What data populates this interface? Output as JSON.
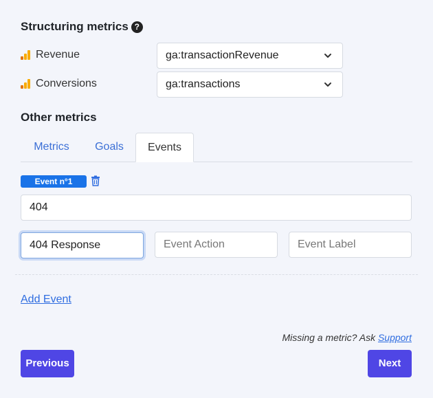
{
  "structuring": {
    "title": "Structuring metrics",
    "help_icon": "?",
    "rows": [
      {
        "label": "Revenue",
        "value": "ga:transactionRevenue"
      },
      {
        "label": "Conversions",
        "value": "ga:transactions"
      }
    ]
  },
  "other": {
    "title": "Other metrics",
    "tabs": [
      "Metrics",
      "Goals",
      "Events"
    ],
    "active_tab": "Events"
  },
  "event": {
    "badge": "Event n°1",
    "category_value": "404",
    "action_value": "404 Response",
    "action_placeholder": "Event Action",
    "label_placeholder": "Event Label"
  },
  "add_event_label": "Add Event",
  "hint": {
    "text": "Missing a metric? Ask ",
    "link": "Support"
  },
  "buttons": {
    "previous": "Previous",
    "next": "Next"
  },
  "colors": {
    "accent": "#4f46e5",
    "badge": "#1a73e8",
    "link": "#2f6de0"
  }
}
